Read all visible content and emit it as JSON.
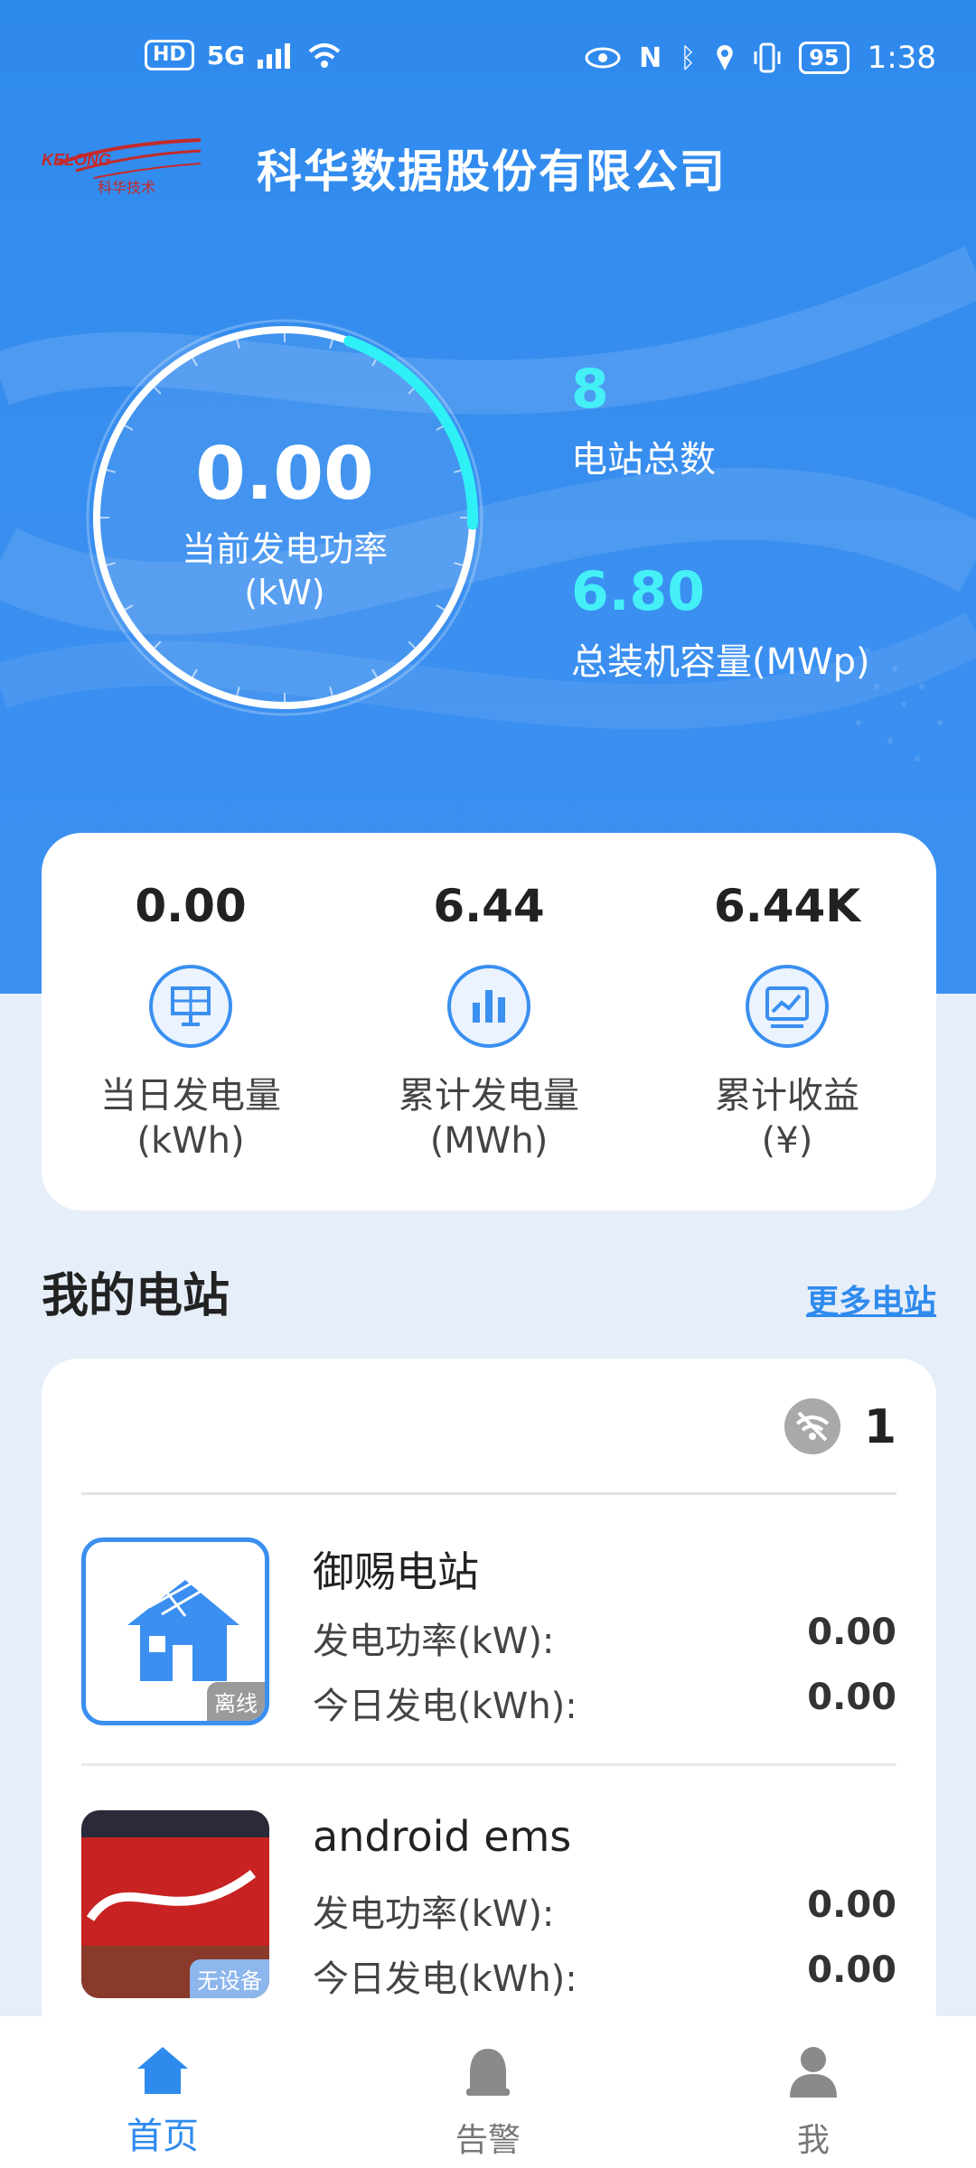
{
  "status_bar": {
    "hd": "HD",
    "network": "5G",
    "battery": "95",
    "time": "1:38"
  },
  "brand": {
    "logo_text": "KELONG",
    "logo_subtext": "科华技术",
    "company_name": "科华数据股份有限公司"
  },
  "gauge": {
    "value": "0.00",
    "label": "当前发电功率",
    "unit": "(kW)",
    "fill_fraction": 0.2
  },
  "kpis": {
    "station_count": "8",
    "station_count_label": "电站总数",
    "capacity": "6.80",
    "capacity_label": "总装机容量(MWp)"
  },
  "summary": [
    {
      "value": "0.00",
      "label": "当日发电量",
      "unit": "(kWh)",
      "icon": "solar-panel-icon"
    },
    {
      "value": "6.44",
      "label": "累计发电量",
      "unit": "(MWh)",
      "icon": "bar-chart-icon"
    },
    {
      "value": "6.44K",
      "label": "累计收益",
      "unit": "(¥)",
      "icon": "trend-chart-icon"
    }
  ],
  "section": {
    "title": "我的电站",
    "more": "更多电站"
  },
  "station_list": {
    "offline_count": "1",
    "stations": [
      {
        "name": "御赐电站",
        "power_label": "发电功率(kW):",
        "power_value": "0.00",
        "today_label": "今日发电(kWh):",
        "today_value": "0.00",
        "tag": "离线",
        "thumb": "house-icon"
      },
      {
        "name": "android ems",
        "power_label": "发电功率(kW):",
        "power_value": "0.00",
        "today_label": "今日发电(kWh):",
        "today_value": "0.00",
        "tag": "无设备",
        "thumb": "photo"
      }
    ]
  },
  "nav": [
    {
      "label": "首页",
      "icon": "home-icon",
      "active": true
    },
    {
      "label": "告警",
      "icon": "bell-icon",
      "active": false
    },
    {
      "label": "我",
      "icon": "user-icon",
      "active": false
    }
  ],
  "colors": {
    "primary": "#2f8aed",
    "accent": "#44f0f6"
  }
}
